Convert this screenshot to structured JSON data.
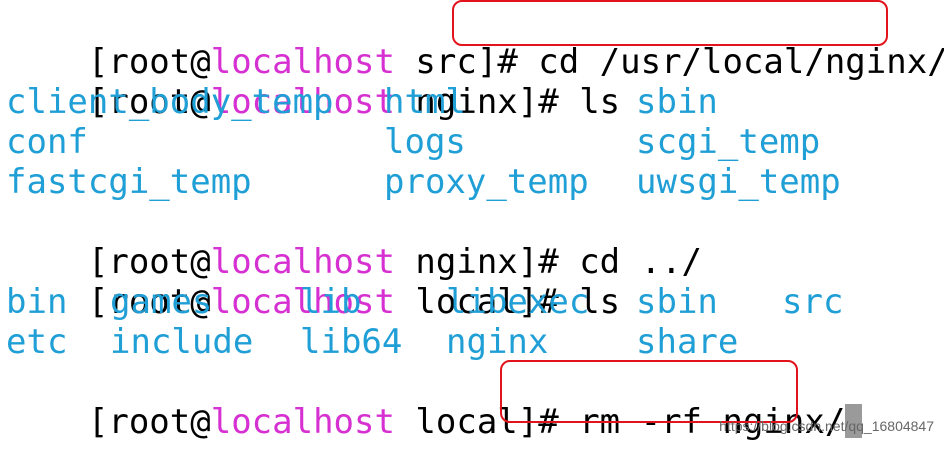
{
  "colors": {
    "background": "#ffffff",
    "text": "#000000",
    "hostname": "#d62fd2",
    "directory": "#1f9fd6",
    "highlight_box": "#e3131b",
    "cursor": "#9a9a9a"
  },
  "terminal": {
    "lines": [
      {
        "type": "prompt",
        "prompt": {
          "open": "[root@",
          "host": "localhost",
          "cwd": " src",
          "close": "]# "
        },
        "command": "cd /usr/local/nginx/"
      },
      {
        "type": "prompt",
        "prompt": {
          "open": "[root@",
          "host": "localhost",
          "cwd": " nginx",
          "close": "]# "
        },
        "command": "ls"
      },
      {
        "type": "ls_output",
        "cells": [
          "client_body_temp",
          "html",
          "sbin"
        ]
      },
      {
        "type": "ls_output",
        "cells": [
          "conf",
          "logs",
          "scgi_temp"
        ]
      },
      {
        "type": "ls_output",
        "cells": [
          "fastcgi_temp",
          "proxy_temp",
          "uwsgi_temp"
        ]
      },
      {
        "type": "prompt",
        "prompt": {
          "open": "[root@",
          "host": "localhost",
          "cwd": " nginx",
          "close": "]# "
        },
        "command": "cd ../"
      },
      {
        "type": "prompt",
        "prompt": {
          "open": "[root@",
          "host": "localhost",
          "cwd": " local",
          "close": "]# "
        },
        "command": "ls"
      },
      {
        "type": "ls_output",
        "cells": [
          "bin",
          "games",
          "lib",
          "libexec",
          "sbin",
          "src"
        ]
      },
      {
        "type": "ls_output",
        "cells": [
          "etc",
          "include",
          "lib64",
          "nginx",
          "share"
        ]
      },
      {
        "type": "prompt",
        "prompt": {
          "open": "[root@",
          "host": "localhost",
          "cwd": " local",
          "close": "]# "
        },
        "command": "rm -rf nginx/"
      }
    ]
  },
  "watermark": "https://blog.csdn.net/qq_16804847"
}
